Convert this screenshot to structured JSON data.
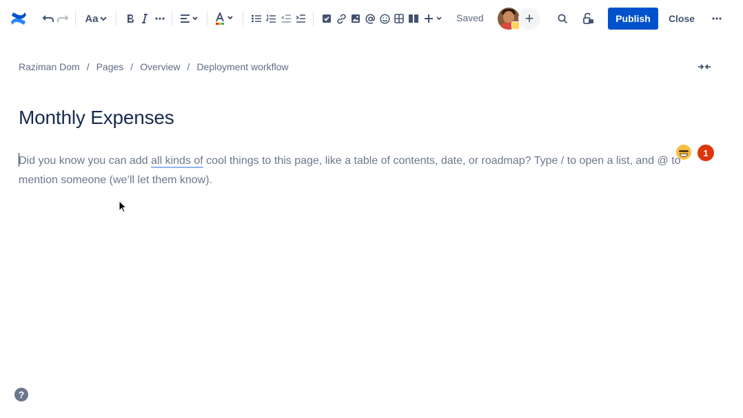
{
  "toolbar": {
    "text_style_label": "Aa",
    "saved_label": "Saved",
    "publish_label": "Publish",
    "close_label": "Close",
    "add_collaborator_label": "+"
  },
  "breadcrumb": {
    "items": [
      "Raziman Dom",
      "Pages",
      "Overview",
      "Deployment workflow"
    ],
    "separator": "/"
  },
  "page": {
    "title": "Monthly Expenses",
    "placeholder_before": "Did you know you can add ",
    "placeholder_highlight": "all kinds of",
    "placeholder_after": " cool things to this page, like a table of contents, date, or roadmap? Type / to open a list, and @ to mention someone (we’ll let them know)."
  },
  "badges": {
    "alert_count": "1"
  },
  "help": {
    "label": "?"
  },
  "colors": {
    "primary_button": "#0052cc",
    "logo_blue": "#2684ff",
    "text_dark": "#172b4d",
    "text_subtle": "#6b778c",
    "alert_red": "#de350b"
  },
  "icons": [
    "confluence-logo-icon",
    "undo-icon",
    "redo-icon",
    "text-style-chevron-icon",
    "bold-icon",
    "italic-icon",
    "more-formatting-icon",
    "align-icon",
    "text-color-icon",
    "bullet-list-icon",
    "numbered-list-icon",
    "outdent-icon",
    "indent-icon",
    "action-item-icon",
    "link-icon",
    "image-icon",
    "mention-icon",
    "emoji-icon",
    "table-icon",
    "layout-icon",
    "insert-icon",
    "search-icon",
    "restrictions-icon",
    "more-icon",
    "collapse-width-icon",
    "help-icon"
  ]
}
